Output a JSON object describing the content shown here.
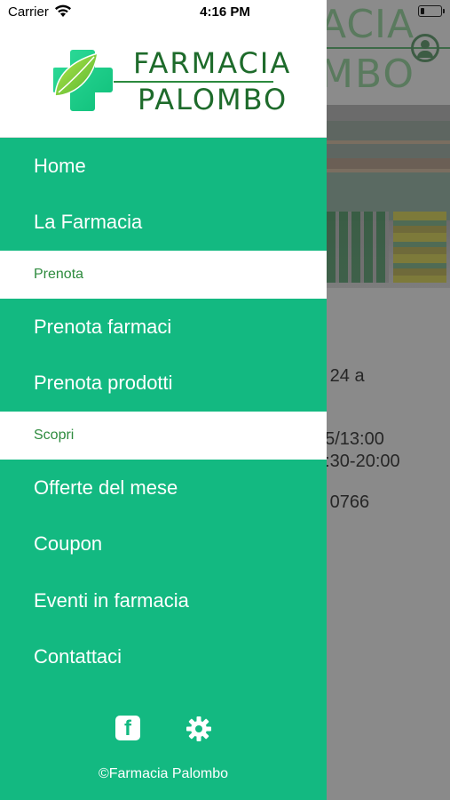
{
  "status_bar": {
    "carrier": "Carrier",
    "time": "4:16 PM"
  },
  "logo": {
    "line1": "FARMACIA",
    "line2": "PALOMBO"
  },
  "background": {
    "logo_line1": "ACIA",
    "logo_line2": "MBO",
    "text_lines": [
      "e 24 a",
      "15/13:00",
      "6:30-20:00",
      "o 0766"
    ]
  },
  "menu": {
    "items_top": [
      {
        "label": "Home"
      },
      {
        "label": "La Farmacia"
      }
    ],
    "section_prenota": "Prenota",
    "items_prenota": [
      {
        "label": "Prenota farmaci"
      },
      {
        "label": "Prenota prodotti"
      }
    ],
    "section_scopri": "Scopri",
    "items_scopri": [
      {
        "label": "Offerte del mese"
      },
      {
        "label": "Coupon"
      },
      {
        "label": "Eventi in farmacia"
      },
      {
        "label": "Contattaci"
      }
    ]
  },
  "footer": {
    "facebook_glyph": "f",
    "copyright": "©Farmacia Palombo"
  },
  "colors": {
    "drawer_green": "#13b981",
    "brand_dark_green": "#1e6b2b",
    "section_text_green": "#2e8b3e"
  }
}
